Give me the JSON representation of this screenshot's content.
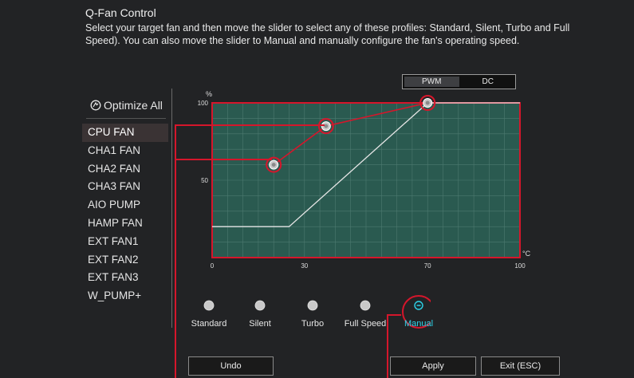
{
  "header": {
    "title": "Q-Fan Control",
    "description": "Select your target fan and then move the slider to select any of these profiles: Standard, Silent, Turbo and Full Speed). You can also move the slider to Manual and manually configure the fan's operating speed."
  },
  "mode_toggle": {
    "pwm_label": "PWM",
    "dc_label": "DC",
    "selected": "PWM"
  },
  "sidebar": {
    "optimize_label": "Optimize All",
    "fans": [
      {
        "label": "CPU FAN"
      },
      {
        "label": "CHA1 FAN"
      },
      {
        "label": "CHA2 FAN"
      },
      {
        "label": "CHA3 FAN"
      },
      {
        "label": "AIO PUMP"
      },
      {
        "label": "HAMP FAN"
      },
      {
        "label": "EXT FAN1"
      },
      {
        "label": "EXT FAN2"
      },
      {
        "label": "EXT FAN3"
      },
      {
        "label": "W_PUMP+"
      }
    ],
    "selected_fan": "CPU FAN"
  },
  "chart_data": {
    "type": "line",
    "y_unit": "%",
    "x_unit": "°C",
    "x_ticks": [
      "0",
      "30",
      "70",
      "100"
    ],
    "y_ticks": [
      "100",
      "50"
    ],
    "xlim": [
      0,
      100
    ],
    "ylim": [
      0,
      100
    ],
    "control_points": [
      {
        "x": 20,
        "y": 60
      },
      {
        "x": 37,
        "y": 85
      },
      {
        "x": 70,
        "y": 100
      }
    ],
    "fan_curve": [
      {
        "x": 0,
        "y": 20
      },
      {
        "x": 25,
        "y": 20
      },
      {
        "x": 70,
        "y": 100
      },
      {
        "x": 100,
        "y": 100
      }
    ],
    "colors": {
      "plot_bg": "#2a5a50",
      "grid": "#4d7a70",
      "curve": "#e6e6e6",
      "accent": "#d5162b"
    }
  },
  "profiles": {
    "items": [
      {
        "label": "Standard"
      },
      {
        "label": "Silent"
      },
      {
        "label": "Turbo"
      },
      {
        "label": "Full Speed"
      },
      {
        "label": "Manual"
      }
    ],
    "selected": "Manual"
  },
  "buttons": {
    "undo": "Undo",
    "apply": "Apply",
    "exit": "Exit (ESC)"
  }
}
